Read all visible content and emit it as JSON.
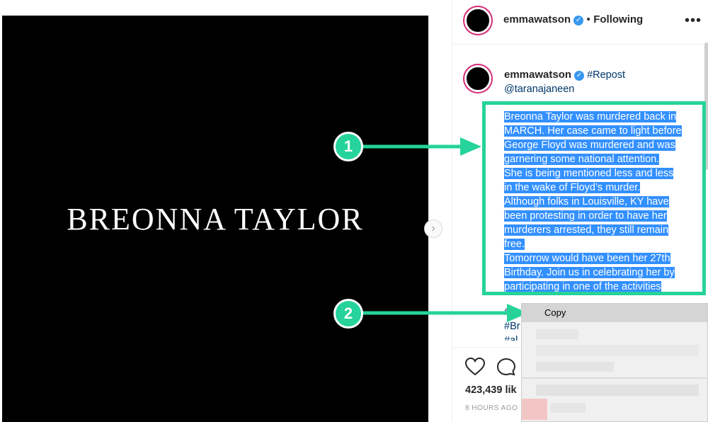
{
  "post": {
    "image_text": "BREONNA TAYLOR",
    "next_icon": "chevron-right-icon"
  },
  "header": {
    "username": "emmawatson",
    "separator": "•",
    "following": "Following",
    "more": "•••"
  },
  "caption": {
    "username": "emmawatson",
    "repost": "#Repost",
    "mention": "@taranajaneen",
    "lines": [
      "Breonna Taylor was murdered back in",
      "MARCH. Her case came to light before",
      "George Floyd was murdered and was",
      "garnering some national attention.",
      "She is being mentioned less and less",
      "in the wake of Floyd’s murder.",
      "Although folks in Louisville, KY have",
      "been protesting in order to have her",
      "murderers arrested, they still remain",
      "free.",
      "Tomorrow would have been her 27th",
      "Birthday. Join us in celebrating her by",
      "participating in one of the activities"
    ],
    "partial_tags": [
      "#",
      "#Br",
      "#al"
    ]
  },
  "actions": {
    "likes": "423,439 lik",
    "time": "8 HOURS AGO"
  },
  "annotations": {
    "badge1": "1",
    "badge2": "2",
    "accent": "#26d39a"
  },
  "context_menu": {
    "copy": "Copy"
  }
}
